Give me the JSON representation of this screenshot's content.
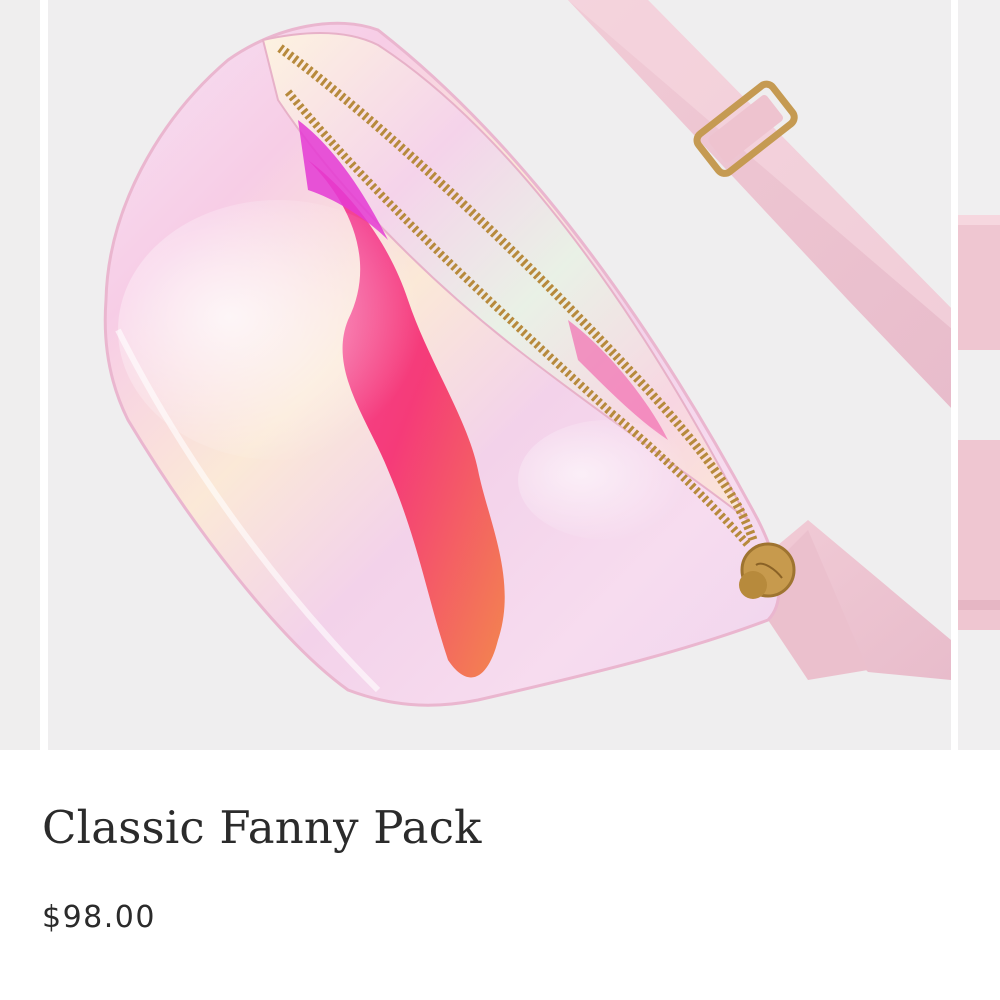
{
  "carousel": {
    "image_subject": "iridescent holographic fanny pack with pink strap and gold zipper",
    "icons": {
      "main_image": "fanny-pack-photo",
      "next_peek": "strap-peek-photo"
    }
  },
  "product": {
    "title": "Classic Fanny Pack",
    "price": "$98.00"
  },
  "colors": {
    "background": "#ffffff",
    "image_backdrop": "#efeeef",
    "strap_pink": "#ecc4cf",
    "zipper_gold": "#b78a3c",
    "text": "#2b2b2b"
  }
}
